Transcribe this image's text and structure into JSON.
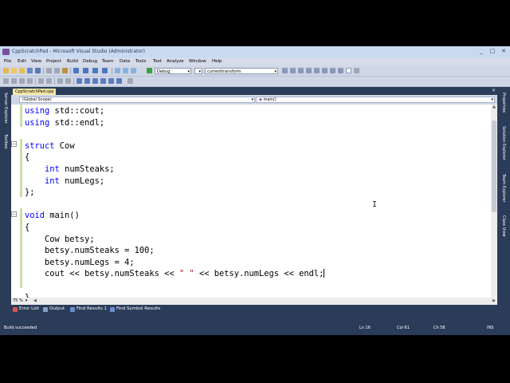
{
  "window": {
    "title": "CppScratchPad - Microsoft Visual Studio (Administrator)",
    "controls": [
      "_",
      "□",
      "✕"
    ]
  },
  "menu": [
    "File",
    "Edit",
    "View",
    "Project",
    "Build",
    "Debug",
    "Team",
    "Data",
    "Tools",
    "Test",
    "Analyze",
    "Window",
    "Help"
  ],
  "toolbar": {
    "config": "Debug",
    "find_combo": "currenttransform"
  },
  "left_rail": {
    "tabs": [
      "Server Explorer",
      "Toolbox"
    ]
  },
  "right_rail": {
    "tabs": [
      "Properties",
      "Solution Explorer",
      "Team Explorer",
      "Class View"
    ]
  },
  "document_tab": "CppScratchPad.cpp",
  "nav_bar": {
    "scope": "(Global Scope)",
    "member": "main()"
  },
  "code_lines": [
    [
      {
        "t": "using",
        "c": "kw"
      },
      {
        "t": " std::cout;"
      }
    ],
    [
      {
        "t": "using",
        "c": "kw"
      },
      {
        "t": " std::endl;"
      }
    ],
    [],
    [
      {
        "t": "struct",
        "c": "kw"
      },
      {
        "t": " Cow"
      }
    ],
    [
      {
        "t": "{"
      }
    ],
    [
      {
        "t": "    "
      },
      {
        "t": "int",
        "c": "kw"
      },
      {
        "t": " numSteaks;"
      }
    ],
    [
      {
        "t": "    "
      },
      {
        "t": "int",
        "c": "kw"
      },
      {
        "t": " numLegs;"
      }
    ],
    [
      {
        "t": "};"
      }
    ],
    [],
    [
      {
        "t": "void",
        "c": "kw"
      },
      {
        "t": " main()"
      }
    ],
    [
      {
        "t": "{"
      }
    ],
    [
      {
        "t": "    Cow betsy;"
      }
    ],
    [
      {
        "t": "    betsy.numSteaks = 100;"
      }
    ],
    [
      {
        "t": "    betsy.numLegs = 4;"
      }
    ],
    [
      {
        "t": "    cout << betsy.numSteaks << "
      },
      {
        "t": "\" \"",
        "c": "str"
      },
      {
        "t": " << betsy.numLegs << endl;"
      },
      {
        "caret": true
      }
    ],
    [],
    [
      {
        "t": "}"
      }
    ]
  ],
  "editor": {
    "zoom": "75 %"
  },
  "bottom_tabs": [
    {
      "label": "Error List",
      "icon": "error-list-icon",
      "color": "#d9534f"
    },
    {
      "label": "Output",
      "icon": "output-icon",
      "color": "#8aa0c8"
    },
    {
      "label": "Find Results 1",
      "icon": "find-results-icon",
      "color": "#6a8fd0"
    },
    {
      "label": "Find Symbol Results",
      "icon": "find-symbol-icon",
      "color": "#6a8fd0"
    }
  ],
  "status": {
    "message": "Build succeeded",
    "line": "Ln 16",
    "col": "Col 61",
    "ch": "Ch 58",
    "mode": "INS"
  },
  "colors": {
    "keyword": "#0000ff",
    "string": "#a31515",
    "chrome": "#2b3c59",
    "active_tab": "#f7e7a4"
  }
}
